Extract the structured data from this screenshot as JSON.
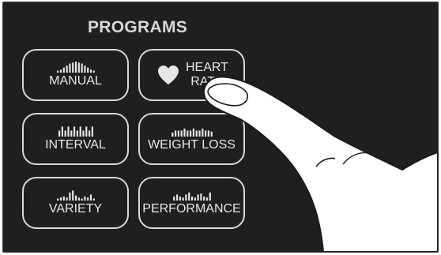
{
  "panel": {
    "title": "PROGRAMS",
    "background": "#1f1f1f",
    "buttons": [
      {
        "label": "MANUAL",
        "icon": "manual-profile-bars-icon",
        "profile": [
          2,
          3,
          5,
          7,
          9,
          10,
          11,
          10,
          9,
          7,
          5,
          3,
          2
        ]
      },
      {
        "label_line1": "HEART",
        "label_line2": "RATE",
        "icon": "heart-icon"
      },
      {
        "label": "INTERVAL",
        "icon": "interval-profile-bars-icon",
        "profile": [
          6,
          10,
          6,
          10,
          6,
          10,
          6,
          10,
          6,
          10,
          6,
          10
        ]
      },
      {
        "label": "WEIGHT LOSS",
        "icon": "weight-loss-profile-bars-icon",
        "profile": [
          4,
          6,
          6,
          6,
          8,
          6,
          6,
          8,
          6,
          6,
          8,
          6,
          6,
          5
        ]
      },
      {
        "label": "VARIETY",
        "icon": "variety-profile-bars-icon",
        "profile": [
          2,
          3,
          4,
          3,
          8,
          10,
          5,
          3,
          2,
          4,
          3,
          6,
          2
        ]
      },
      {
        "label": "PERFORMANCE",
        "icon": "performance-profile-bars-icon",
        "profile": [
          4,
          6,
          4,
          3,
          6,
          8,
          4,
          3,
          6,
          7,
          4,
          3,
          8
        ]
      }
    ]
  }
}
